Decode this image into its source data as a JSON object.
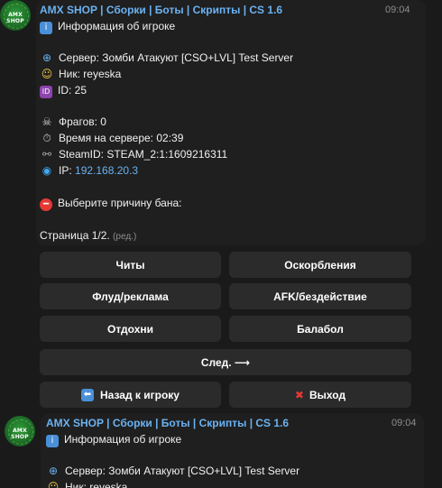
{
  "message1": {
    "sender": "AMX SHOP | Сборки | Боты | Скрипты | CS 1.6",
    "time": "09:04",
    "avatar_text": "AMX SHOP",
    "header": "Информация об игроке",
    "server": "Сервер: Зомби Атакуют [CSO+LVL] Test Server",
    "nick": "Ник: reyeska",
    "id": "ID: 25",
    "frags": "Фрагов: 0",
    "time_on_server": "Время на сервере: 02:39",
    "steamid": "SteamID: STEAM_2:1:1609216311",
    "ip_label": "IP:",
    "ip_value": "192.168.20.3",
    "ban_prompt": "Выберите причину бана:",
    "page": "Страница 1/2.",
    "edited": "(ред.)"
  },
  "keyboard": {
    "cheats": "Читы",
    "insults": "Оскорбления",
    "flood": "Флуд/реклама",
    "afk": "AFK/бездействие",
    "rest": "Отдохни",
    "chatter": "Балабол",
    "next": "След. ⟶",
    "back": "Назад к игроку",
    "exit": "Выход"
  },
  "message2": {
    "sender": "AMX SHOP | Сборки | Боты | Скрипты | CS 1.6",
    "time": "09:04",
    "avatar_text": "AMX SHOP",
    "header": "Информация об игроке",
    "server": "Сервер: Зомби Атакуют [CSO+LVL] Test Server",
    "nick": "Ник: reyeska"
  },
  "icons": {
    "info": "info-icon",
    "globe": "globe-icon",
    "face": "face-icon",
    "id": "id-badge-icon",
    "skull": "skull-icon",
    "stopwatch": "stopwatch-icon",
    "link": "link-icon",
    "earth": "earth-icon",
    "no_entry": "no-entry-icon",
    "back": "back-arrow-icon",
    "cross": "cross-icon"
  },
  "colors": {
    "background": "#1a1a1a",
    "bubble": "#1f1f1f",
    "accent_link": "#6ab2f2",
    "button": "#2b2b2b",
    "muted": "#8d8d8d"
  }
}
